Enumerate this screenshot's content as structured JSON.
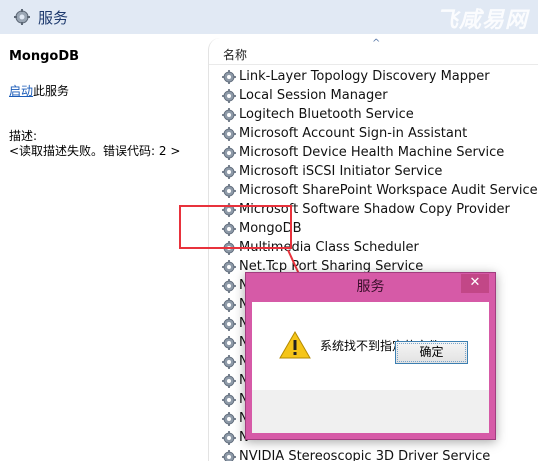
{
  "window": {
    "title": "服务"
  },
  "watermark": "飞咸易网",
  "detail": {
    "service_name": "MongoDB",
    "start_link": "启动",
    "start_suffix": "此服务",
    "description_label": "描述:",
    "description_text": "<读取描述失败。错误代码: 2 >"
  },
  "list": {
    "column_name": "名称",
    "sort_indicator": "^",
    "rows": [
      "Link-Layer Topology Discovery Mapper",
      "Local Session Manager",
      "Logitech Bluetooth Service",
      "Microsoft Account Sign-in Assistant",
      "Microsoft Device Health Machine Service",
      "Microsoft iSCSI Initiator Service",
      "Microsoft SharePoint Workspace Audit Service",
      "Microsoft Software Shadow Copy Provider",
      "MongoDB",
      "Multimedia Class Scheduler",
      "Net.Tcp Port Sharing Service",
      "N",
      "N",
      "N",
      "N",
      "N",
      "N",
      "N",
      "N",
      "N",
      "NVIDIA Stereoscopic 3D Driver Service"
    ],
    "highlighted_row": "MongoDB"
  },
  "dialog": {
    "title": "服务",
    "close_glyph": "✕",
    "message": "系统找不到指定的文件。",
    "ok_label": "确定",
    "icon": "warning-icon"
  },
  "colors": {
    "header_bg": "#e1e9f4",
    "dialog_frame": "#d65aa7",
    "highlight": "#e8323c",
    "link": "#1a5bb8"
  }
}
